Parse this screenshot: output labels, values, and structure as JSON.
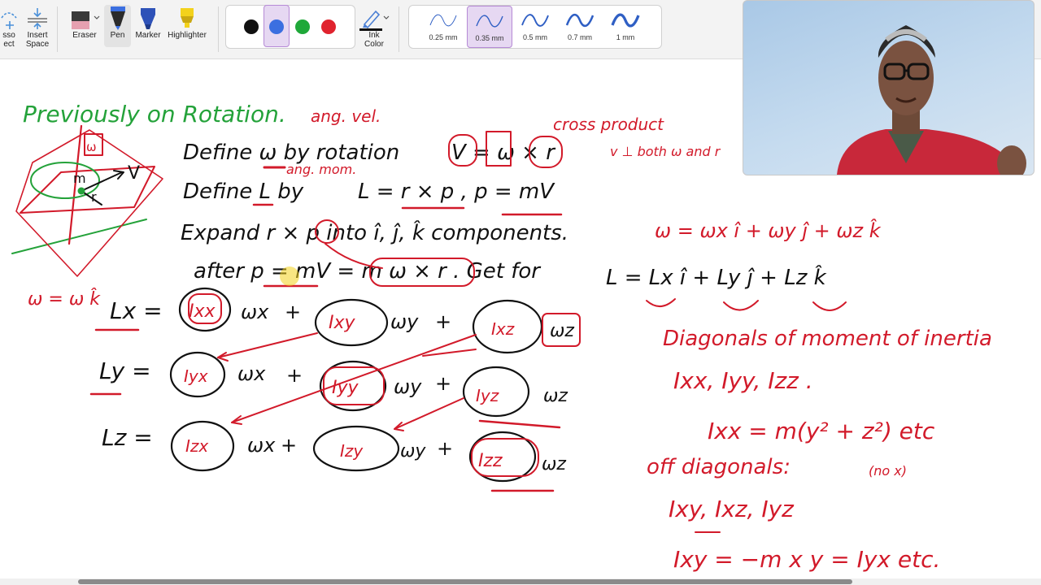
{
  "toolbar": {
    "lasso_label_line1": "sso",
    "lasso_label_line2": "ect",
    "insert_space_line1": "Insert",
    "insert_space_line2": "Space",
    "eraser_label": "Eraser",
    "pen_label": "Pen",
    "marker_label": "Marker",
    "highlighter_label": "Highlighter",
    "ink_color_line1": "Ink",
    "ink_color_line2": "Color",
    "colors": [
      "#111111",
      "#3b6fe0",
      "#1fa839",
      "#e0232e"
    ],
    "selected_color": "#3b6fe0",
    "widths": [
      "0.25 mm",
      "0.35 mm",
      "0.5 mm",
      "0.7 mm",
      "1 mm"
    ],
    "selected_width": "0.35 mm"
  },
  "notes": {
    "heading": "Previously on Rotation.",
    "ang_vel": "ang. vel.",
    "cross_product": "cross product",
    "v_perp": "v ⊥ both ω and r",
    "line1": "Define ω by rotation",
    "line1_eq": "V = ω × r",
    "ang_mom": "ang. mom.",
    "line2": "Define L by",
    "line2_eq": "L = r × p ,  p = mV",
    "line3": "Expand r × p into î, ĵ, k̂ components.",
    "omega_eq": "ω = ωx î + ωy ĵ + ωz k̂",
    "line4": "after p = mV = m ω × r . Get for",
    "L_eq": "L = Lx î + Ly ĵ + Lz k̂",
    "Lx": "Lx =",
    "Ly": "Ly =",
    "Lz": "Lz =",
    "Ixx": "Ixx",
    "Ixy": "Ixy",
    "Ixz": "Ixz",
    "Iyx": "Iyx",
    "Iyy": "Iyy",
    "Iyz": "Iyz",
    "Izx": "Izx",
    "Izy": "Izy",
    "Izz": "Izz",
    "wx": "ωx",
    "wy": "ωy",
    "wz": "ωz",
    "plus": "+",
    "diag_heading": "Diagonals of moment of inertia",
    "diag_list": "Ixx, Iyy, Izz .",
    "diag_formula": "Ixx = m(y² + z²)   etc",
    "offdiag_heading": "off diagonals:",
    "no_x": "(no x)",
    "offdiag_list": "Ixy, Ixz, Iyz",
    "offdiag_formula": "Ixy = −m x y = Iyx   etc.",
    "omega_k": "ω = ω k̂",
    "sketch_v": "V",
    "sketch_m": "m",
    "sketch_r": "r",
    "sketch_w": "ω"
  },
  "colors": {
    "ink_black": "#111111",
    "ink_red": "#d21a2a",
    "ink_green": "#24a23a",
    "ink_blue": "#3b6fe0",
    "highlighter": "#f3d21c"
  }
}
